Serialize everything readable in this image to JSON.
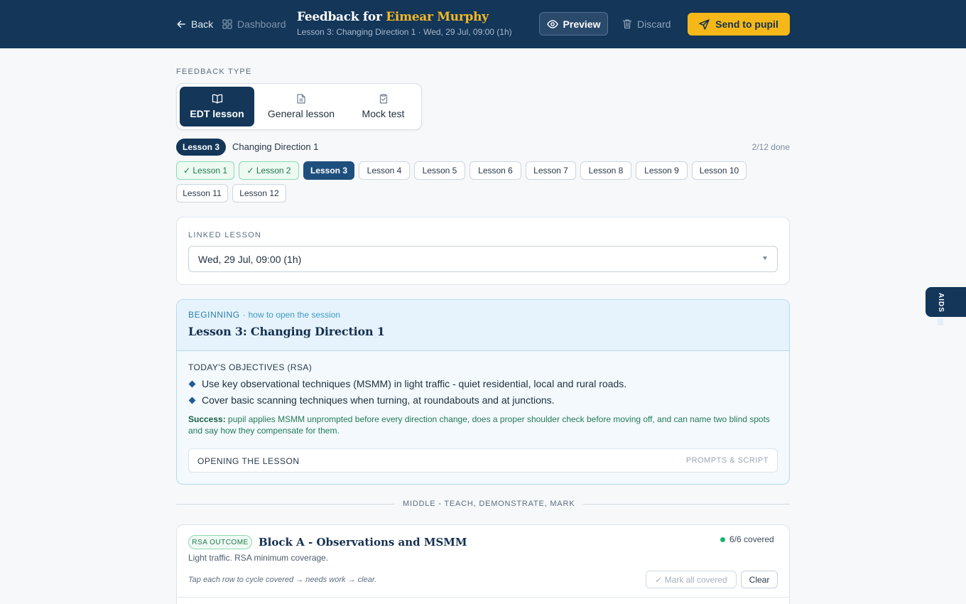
{
  "header": {
    "back_label": "Back",
    "dashboard_label": "Dashboard",
    "title_prefix": "Feedback for",
    "pupil_name": "Eimear Murphy",
    "subtitle": "Lesson 3: Changing Direction 1 · Wed, 29 Jul, 09:00 (1h)",
    "preview_label": "Preview",
    "discard_label": "Discard",
    "send_label": "Send to pupil"
  },
  "feedback_type": {
    "label": "FEEDBACK TYPE",
    "options": [
      {
        "label": "EDT lesson",
        "icon": "book-open-icon",
        "active": true
      },
      {
        "label": "General lesson",
        "icon": "document-icon",
        "active": false
      },
      {
        "label": "Mock test",
        "icon": "clipboard-check-icon",
        "active": false
      }
    ]
  },
  "lessons": {
    "current_badge": "Lesson 3",
    "current_name": "Changing Direction 1",
    "progress": "2/12 done",
    "items": [
      {
        "label": "✓ Lesson 1",
        "state": "done"
      },
      {
        "label": "✓ Lesson 2",
        "state": "done"
      },
      {
        "label": "Lesson 3",
        "state": "current"
      },
      {
        "label": "Lesson 4",
        "state": "todo"
      },
      {
        "label": "Lesson 5",
        "state": "todo"
      },
      {
        "label": "Lesson 6",
        "state": "todo"
      },
      {
        "label": "Lesson 7",
        "state": "todo"
      },
      {
        "label": "Lesson 8",
        "state": "todo"
      },
      {
        "label": "Lesson 9",
        "state": "todo"
      },
      {
        "label": "Lesson 10",
        "state": "todo"
      },
      {
        "label": "Lesson 11",
        "state": "todo"
      },
      {
        "label": "Lesson 12",
        "state": "todo"
      }
    ]
  },
  "linked_lesson": {
    "label": "LINKED LESSON",
    "value": "Wed, 29 Jul, 09:00 (1h)"
  },
  "beginning": {
    "label": "BEGINNING",
    "separator": "·",
    "hint": "how to open the session",
    "title": "Lesson 3: Changing Direction 1",
    "objectives_label": "TODAY'S OBJECTIVES (RSA)",
    "objectives": [
      "Use key observational techniques (MSMM) in light traffic - quiet residential, local and rural roads.",
      "Cover basic scanning techniques when turning, at roundabouts and at junctions."
    ],
    "success_label": "Success:",
    "success_text": "pupil applies MSMM unprompted before every direction change, does a proper shoulder check before moving off, and can name two blind spots and say how they compensate for them.",
    "opening_label": "OPENING THE LESSON",
    "opening_action": "PROMPTS & SCRIPT"
  },
  "middle": {
    "divider": "MIDDLE - TEACH, DEMONSTRATE, MARK"
  },
  "block_a": {
    "badge": "RSA OUTCOME",
    "title": "Block A - Observations and MSMM",
    "covered": "6/6 covered",
    "subtitle": "Light traffic. RSA minimum coverage.",
    "hint": "Tap each row to cycle covered → needs work → clear.",
    "mark_all_label": "✓ Mark all covered",
    "clear_label": "Clear"
  },
  "side_tab": {
    "label": "AIDS"
  },
  "colors": {
    "navy": "#133659",
    "accent_yellow": "#f5b818",
    "success_green": "#19b36b"
  }
}
